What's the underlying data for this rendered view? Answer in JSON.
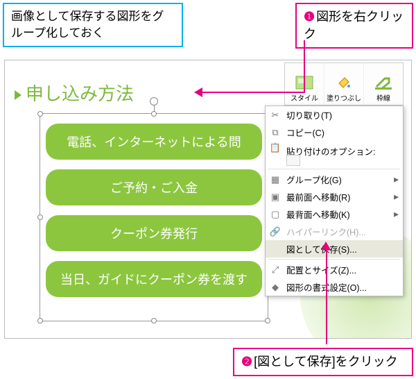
{
  "notes": {
    "top_left": "画像として保存する図形をグループ化しておく"
  },
  "callouts": {
    "top": {
      "num": "❶",
      "text": "図形を右クリック"
    },
    "bottom": {
      "num": "❷",
      "text": "[図として保存]をクリック"
    }
  },
  "slide": {
    "title": "申し込み方法",
    "shapes": [
      "電話、インターネットによる問",
      "ご予約・ご入金",
      "クーポン券発行",
      "当日、ガイドにクーポン券を渡す"
    ]
  },
  "mini_toolbar": {
    "style": "スタイル",
    "fill": "塗りつぶし",
    "outline": "枠線"
  },
  "context_menu": {
    "cut": "切り取り(T)",
    "copy": "コピー(C)",
    "paste_opts": "貼り付けのオプション:",
    "group": "グループ化(G)",
    "bring_front": "最前面へ移動(R)",
    "send_back": "最背面へ移動(K)",
    "hyperlink": "ハイパーリンク(H)...",
    "save_as_picture": "図として保存(S)...",
    "size_pos": "配置とサイズ(Z)...",
    "format_shape": "図形の書式設定(O)..."
  }
}
